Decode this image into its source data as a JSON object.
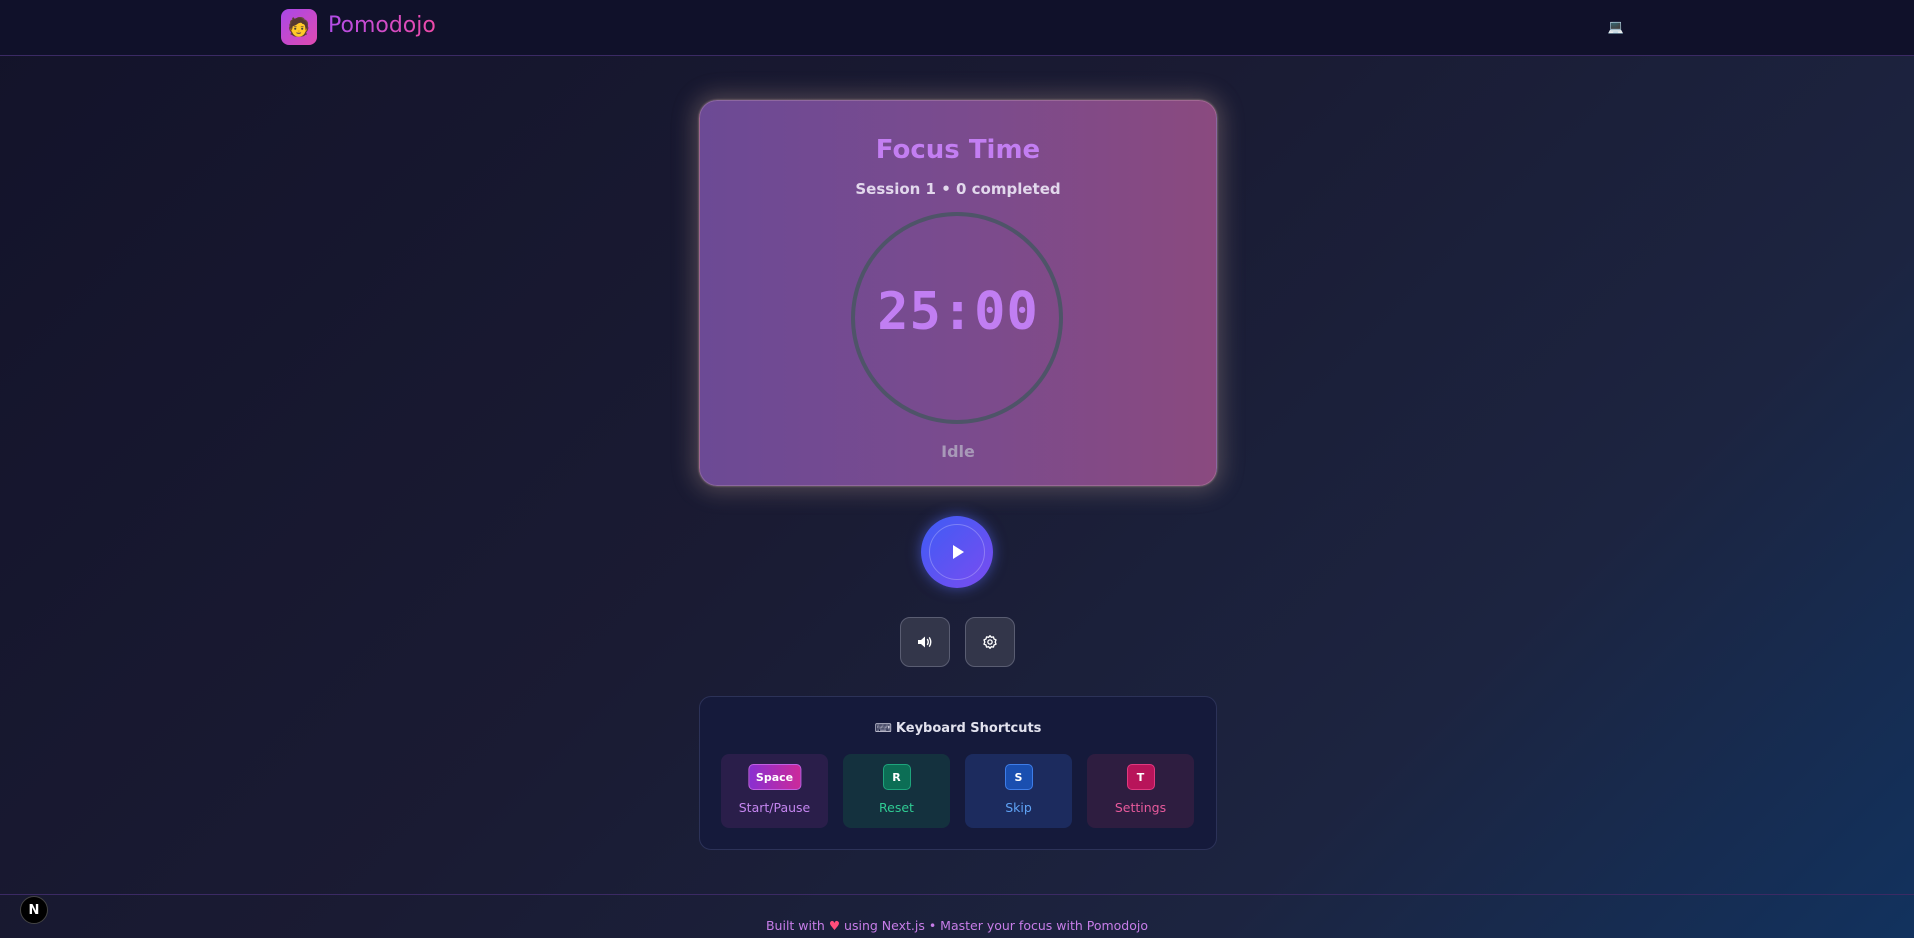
{
  "header": {
    "brand": "Pomodojo",
    "logo_icon": "🧑",
    "theme_icon": "💻"
  },
  "timer": {
    "title": "Focus Time",
    "session": "Session 1 • 0 completed",
    "time": "25:00",
    "state": "Idle"
  },
  "controls": {
    "play_icon": "play-icon",
    "sound_icon": "speaker-icon",
    "settings_icon": "gear-icon"
  },
  "shortcuts": {
    "title": "Keyboard Shortcuts",
    "title_icon": "⌨",
    "items": [
      {
        "key": "Space",
        "label": "Start/Pause"
      },
      {
        "key": "R",
        "label": "Reset"
      },
      {
        "key": "S",
        "label": "Skip"
      },
      {
        "key": "T",
        "label": "Settings"
      }
    ]
  },
  "footer": {
    "prefix": "Built with",
    "heart": "♥",
    "suffix": "using Next.js • Master your focus with Pomodojo"
  },
  "next_badge": "N",
  "colors": {
    "accent_purple": "#c17ef2",
    "brand_gradient_start": "#b24de8",
    "brand_gradient_end": "#ee4aa8",
    "play_button": "#3d5cf5"
  }
}
